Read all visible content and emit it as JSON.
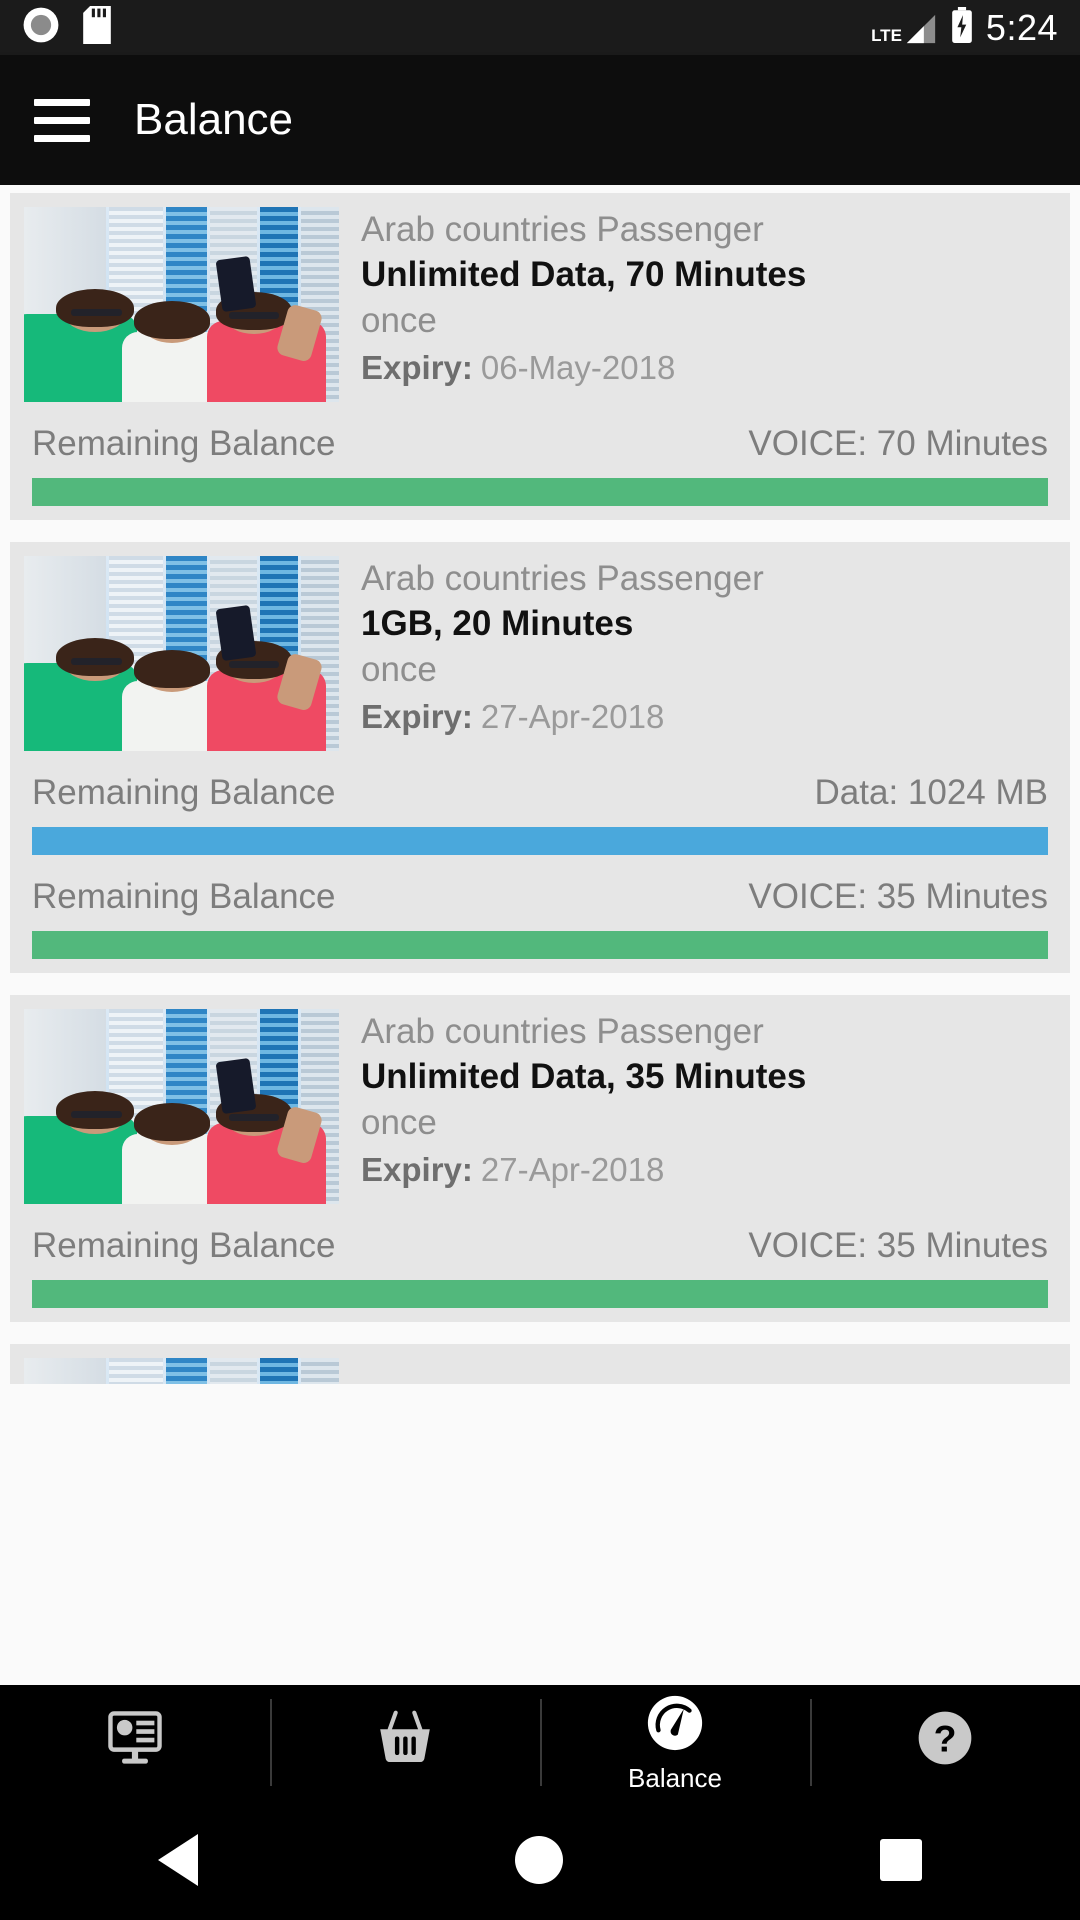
{
  "status_bar": {
    "icons": [
      "record-circle-icon",
      "sd-card-icon"
    ],
    "network_type": "LTE",
    "battery": "charging",
    "clock": "5:24"
  },
  "app_bar": {
    "menu_icon": "hamburger-menu-icon",
    "title": "Balance"
  },
  "cards": [
    {
      "provider": "Arab countries Passenger",
      "plan": "Unlimited Data, 70 Minutes",
      "frequency": "once",
      "expiry_label": "Expiry:",
      "expiry_value": "06-May-2018",
      "balances": [
        {
          "label": "Remaining Balance",
          "value": "VOICE: 70 Minutes",
          "bar_color": "#52b87c",
          "bar_percent": 100
        }
      ]
    },
    {
      "provider": "Arab countries Passenger",
      "plan": "1GB, 20 Minutes",
      "frequency": "once",
      "expiry_label": "Expiry:",
      "expiry_value": "27-Apr-2018",
      "balances": [
        {
          "label": "Remaining Balance",
          "value": "Data: 1024 MB",
          "bar_color": "#4aa8dc",
          "bar_percent": 100
        },
        {
          "label": "Remaining Balance",
          "value": "VOICE: 35 Minutes",
          "bar_color": "#52b87c",
          "bar_percent": 100
        }
      ]
    },
    {
      "provider": "Arab countries Passenger",
      "plan": "Unlimited Data, 35 Minutes",
      "frequency": "once",
      "expiry_label": "Expiry:",
      "expiry_value": "27-Apr-2018",
      "balances": [
        {
          "label": "Remaining Balance",
          "value": "VOICE: 35 Minutes",
          "bar_color": "#52b87c",
          "bar_percent": 100
        }
      ]
    }
  ],
  "tab_bar": {
    "tabs": [
      {
        "icon": "dashboard-monitor-icon",
        "label": "",
        "active": false
      },
      {
        "icon": "shopping-basket-icon",
        "label": "",
        "active": false
      },
      {
        "icon": "gauge-icon",
        "label": "Balance",
        "active": true
      },
      {
        "icon": "help-question-icon",
        "label": "",
        "active": false
      }
    ]
  },
  "nav_bar": {
    "back": "back-triangle-icon",
    "home": "home-circle-icon",
    "recents": "recents-square-icon"
  },
  "colors": {
    "card_bg": "#e6e6e6",
    "voice_bar": "#52b87c",
    "data_bar": "#4aa8dc",
    "appbar_bg": "#0d0d0d"
  }
}
